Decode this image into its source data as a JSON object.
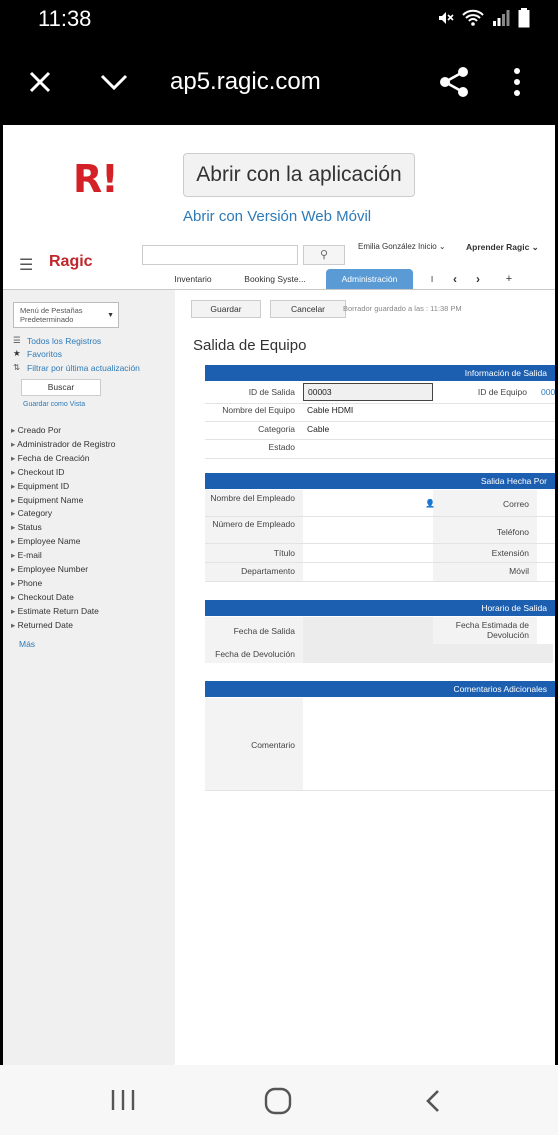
{
  "status": {
    "time": "11:38"
  },
  "browser": {
    "url": "ap5.ragic.com"
  },
  "banner": {
    "logo": "R!",
    "open_app": "Abrir con la aplicación",
    "open_web": "Abrir con Versión Web Móvil"
  },
  "header": {
    "brand": "Ragic",
    "search_placeholder": "",
    "user": "Emilia González Inicio ⌄",
    "learn": "Aprender Ragic ⌄",
    "tabs": [
      "Inventario",
      "Booking Syste...",
      "Administración",
      "I"
    ],
    "add_tab": "+"
  },
  "sidebar": {
    "menu_label": "Menú de Pestañas Predeterminado",
    "links": [
      "Todos los Registros",
      "Favoritos",
      "Filtrar por última actualización"
    ],
    "search_button": "Buscar",
    "save_view": "Guardar como Vista",
    "fields": [
      "Creado Por",
      "Administrador de Registro",
      "Fecha de Creación",
      "Checkout ID",
      "Equipment ID",
      "Equipment Name",
      "Category",
      "Status",
      "Employee Name",
      "E-mail",
      "Employee Number",
      "Phone",
      "Checkout Date",
      "Estimate Return Date",
      "Returned Date"
    ],
    "more": "Más"
  },
  "toolbar": {
    "save": "Guardar",
    "cancel": "Cancelar",
    "draft": "Borrador guardado a las : 11:38 PM"
  },
  "form": {
    "title": "Salida de Equipo",
    "sections": {
      "info": "Información de Salida",
      "by": "Salida Hecha Por",
      "schedule": "Horario de Salida",
      "comments": "Comentarios Adicionales"
    },
    "info": {
      "id_label": "ID de Salida",
      "id_value": "00003",
      "equip_id_label": "ID de Equipo",
      "equip_id_value": "000",
      "equip_name_label": "Nombre del Equipo",
      "equip_name_value": "Cable HDMI",
      "category_label": "Categoria",
      "category_value": "Cable",
      "status_label": "Estado"
    },
    "by": {
      "employee_name": "Nombre del Empleado",
      "email": "Correo",
      "employee_number": "Número de Empleado",
      "phone": "Teléfono",
      "title": "Título",
      "extension": "Extensión",
      "department": "Departamento",
      "mobile": "Móvil"
    },
    "schedule": {
      "checkout_date": "Fecha de Salida",
      "estimated_return": "Fecha Estimada de Devolución",
      "return_date": "Fecha de Devolución"
    },
    "comments": {
      "comment": "Comentario"
    }
  }
}
